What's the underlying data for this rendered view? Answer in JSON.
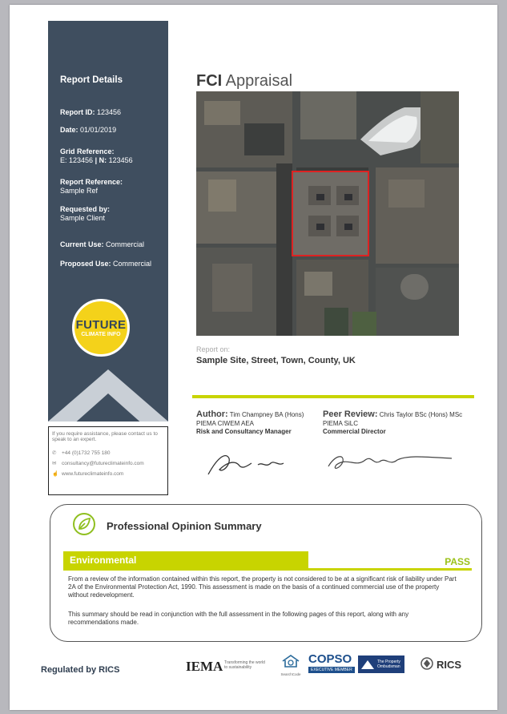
{
  "sidebar": {
    "title": "Report Details",
    "report_id_label": "Report ID:",
    "report_id": "123456",
    "date_label": "Date:",
    "date": "01/01/2019",
    "grid_label": "Grid Reference:",
    "grid_e_label": "E:",
    "grid_e": "123456",
    "grid_sep": "|",
    "grid_n_label": "N:",
    "grid_n": "123456",
    "report_ref_label": "Report Reference:",
    "report_ref": "Sample Ref",
    "requested_label": "Requested by:",
    "requested": "Sample Client",
    "current_use_label": "Current Use:",
    "current_use": "Commercial",
    "proposed_use_label": "Proposed Use:",
    "proposed_use": "Commercial",
    "logo_line1": "FUTURE",
    "logo_line2": "CLIMATE INFO"
  },
  "contact": {
    "intro": "If you require assistance, please contact us to speak to an expert.",
    "phone": "+44 (0)1732 755 180",
    "email": "consultancy@futureclimateinfo.com",
    "web": "www.futureclimateinfo.com",
    "phone_icon": "phone-icon",
    "email_icon": "email-icon",
    "web_icon": "pointer-icon"
  },
  "title": {
    "bold": "FCI",
    "rest": " Appraisal"
  },
  "site": {
    "label": "Report on:",
    "address": "Sample Site, Street, Town, County, UK"
  },
  "author": {
    "label": "Author:",
    "name": "Tim Champney BA (Hons) PIEMA CIWEM AEA",
    "role": "Risk and Consultancy Manager"
  },
  "peer": {
    "label": "Peer Review:",
    "name": "Chris Taylor BSc (Hons) MSc PIEMA SiLC",
    "role": "Commercial Director"
  },
  "summary": {
    "title": "Professional Opinion Summary",
    "icon": "leaf-icon",
    "category": "Environmental",
    "result": "PASS",
    "para1": "From a review of the information contained within this report, the property is not considered to be at a significant risk of liability under Part 2A of the Environmental Protection Act, 1990. This assessment is made on the basis of a continued commercial use of the property without redevelopment.",
    "para2": "This summary should be read in conjunction with the full assessment in the following pages of this report, along with any recommendations made."
  },
  "footer": {
    "regulated": "Regulated by RICS",
    "iema": "IEMA",
    "iema_sub": "Transforming the world to sustainability",
    "searchcode": "SearchCode",
    "copso": "COPSO",
    "copso_sub": "EXECUTIVE MEMBER",
    "ombudsman_l1": "The Property",
    "ombudsman_l2": "Ombudsman",
    "rics": "RICS"
  },
  "colors": {
    "sidebar": "#3f4e5f",
    "accent": "#c8d400",
    "pass": "#9cc21a",
    "logo": "#f4d21a"
  }
}
